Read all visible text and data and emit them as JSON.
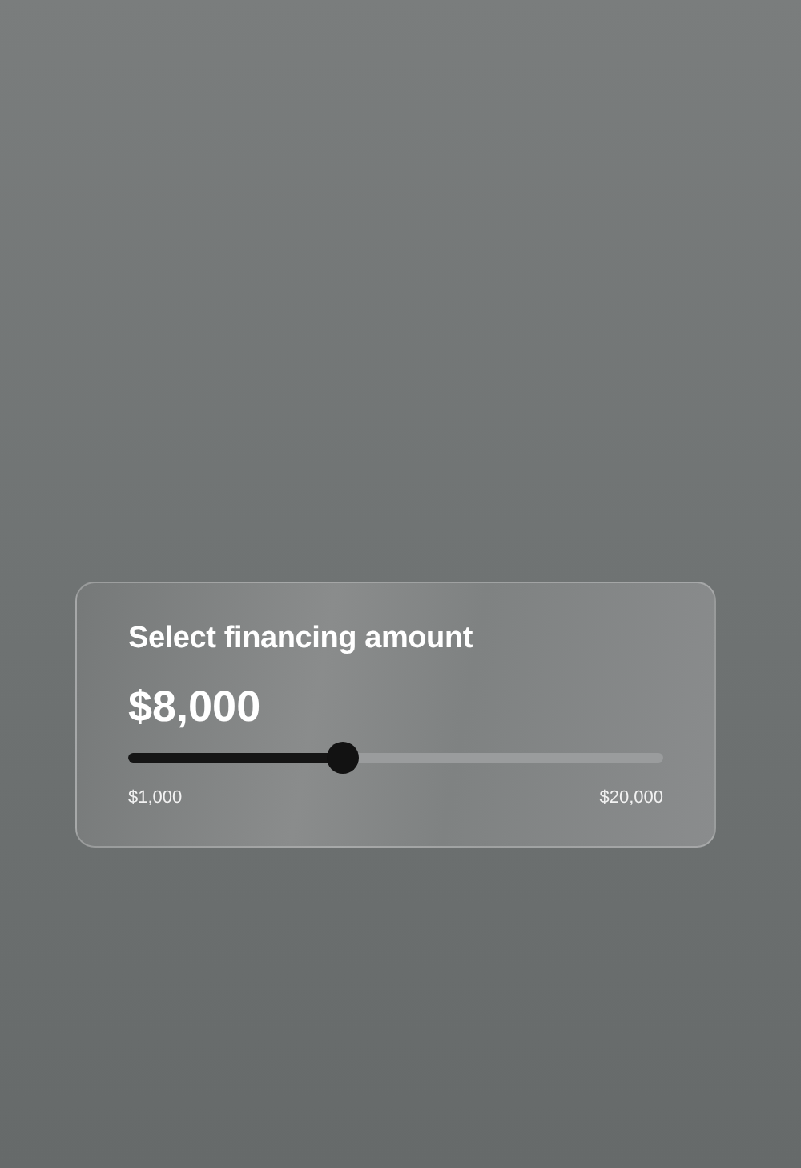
{
  "card": {
    "title": "Select financing amount",
    "amount": "$8,000",
    "slider": {
      "level": 0.4,
      "min_label": "$1,000",
      "max_label": "$20,000"
    }
  }
}
